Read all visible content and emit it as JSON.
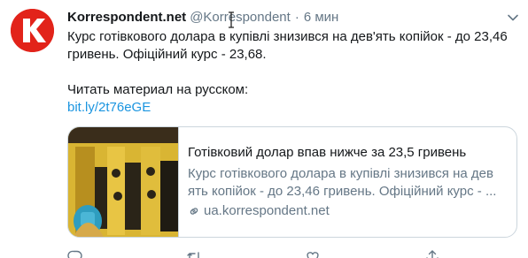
{
  "tweet": {
    "author_name": "Korrespondent.net",
    "author_handle": "@Korrespondent",
    "separator": "·",
    "time": "6 мин",
    "avatar_letter": "K",
    "text_line1": "Курс готівкового долара в купівлі знизився на дев'ять копійок - до 23,46",
    "text_line2": "гривень. Офіційний курс - 23,68.",
    "text_line3": "Читать материал на русском:",
    "link": "bit.ly/2t76eGE"
  },
  "card": {
    "title": "Готівковий долар впав нижче за 23,5 гривень",
    "description_line1": "Курс готівкового долара в купівлі знизився на дев",
    "description_line2": "ять копійок - до 23,46 гривень. Офіційний курс - ...",
    "domain": "ua.korrespondent.net"
  },
  "icons": {
    "avatar": "korrespondent-logo",
    "caret": "chevron-down-icon",
    "link": "link-icon",
    "reply": "reply-icon",
    "retweet": "retweet-icon",
    "like": "heart-icon",
    "share": "share-icon"
  },
  "colors": {
    "brand_red": "#e2231a",
    "link_blue": "#1b95e0",
    "secondary_gray": "#657786",
    "border": "#ccd6dd"
  }
}
